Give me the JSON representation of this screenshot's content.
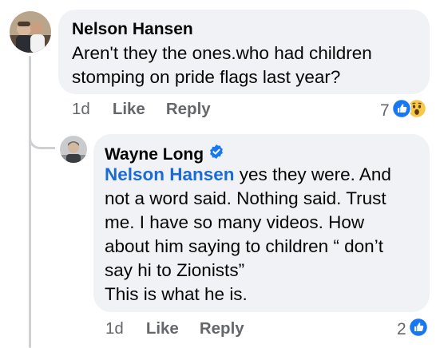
{
  "comment": {
    "author": "Nelson Hansen",
    "text_line1": "Aren't they the ones.who had children",
    "text_line2": "stomping on pride flags last year?",
    "time": "1d",
    "like_label": "Like",
    "reply_label": "Reply",
    "reaction_count": "7",
    "reactions": [
      "like",
      "wow"
    ]
  },
  "reply": {
    "author": "Wayne Long",
    "verified": true,
    "mention": "Nelson Hansen",
    "line1_rest": " yes they were. And",
    "line2": "not a word said. Nothing said. Trust",
    "line3": "me. I have so many videos. How",
    "line4": "about him saying to children “ don’t",
    "line5": "say hi to Zionists”",
    "line6": "This is what he is.",
    "time": "1d",
    "like_label": "Like",
    "reply_label": "Reply",
    "reaction_count": "2",
    "reactions": [
      "like"
    ]
  },
  "colors": {
    "bubble": "#f0f2f5",
    "mention": "#1b6bd6",
    "like_blue": "#1877f2",
    "secondary_text": "#65676b"
  }
}
